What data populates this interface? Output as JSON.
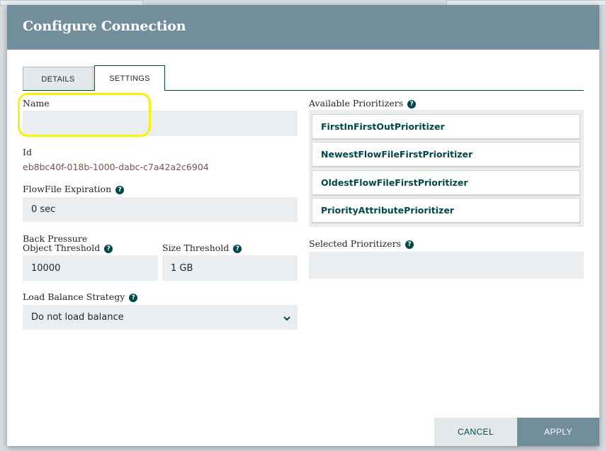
{
  "dialog": {
    "title": "Configure Connection"
  },
  "tabs": [
    {
      "label": "DETAILS"
    },
    {
      "label": "SETTINGS"
    }
  ],
  "fields": {
    "name": {
      "label": "Name",
      "value": ""
    },
    "id": {
      "label": "Id",
      "value": "eb8bc40f-018b-1000-dabc-c7a42a2c6904"
    },
    "flowfile_expiration": {
      "label": "FlowFile Expiration",
      "value": "0 sec"
    },
    "back_pressure": {
      "label": "Back Pressure"
    },
    "object_threshold": {
      "label": "Object Threshold",
      "value": "10000"
    },
    "size_threshold": {
      "label": "Size Threshold",
      "value": "1 GB"
    },
    "load_balance_strategy": {
      "label": "Load Balance Strategy",
      "value": "Do not load balance"
    }
  },
  "prioritizers": {
    "available_label": "Available Prioritizers",
    "available": [
      "FirstInFirstOutPrioritizer",
      "NewestFlowFileFirstPrioritizer",
      "OldestFlowFileFirstPrioritizer",
      "PriorityAttributePrioritizer"
    ],
    "selected_label": "Selected Prioritizers"
  },
  "help_glyph": "?",
  "icons": {
    "help": "help-icon",
    "dropdown": "chevron-down-icon"
  },
  "buttons": {
    "cancel": "CANCEL",
    "apply": "APPLY"
  },
  "colors": {
    "header": "#728e9b",
    "accent": "#004849",
    "highlight": "#f6f400"
  }
}
